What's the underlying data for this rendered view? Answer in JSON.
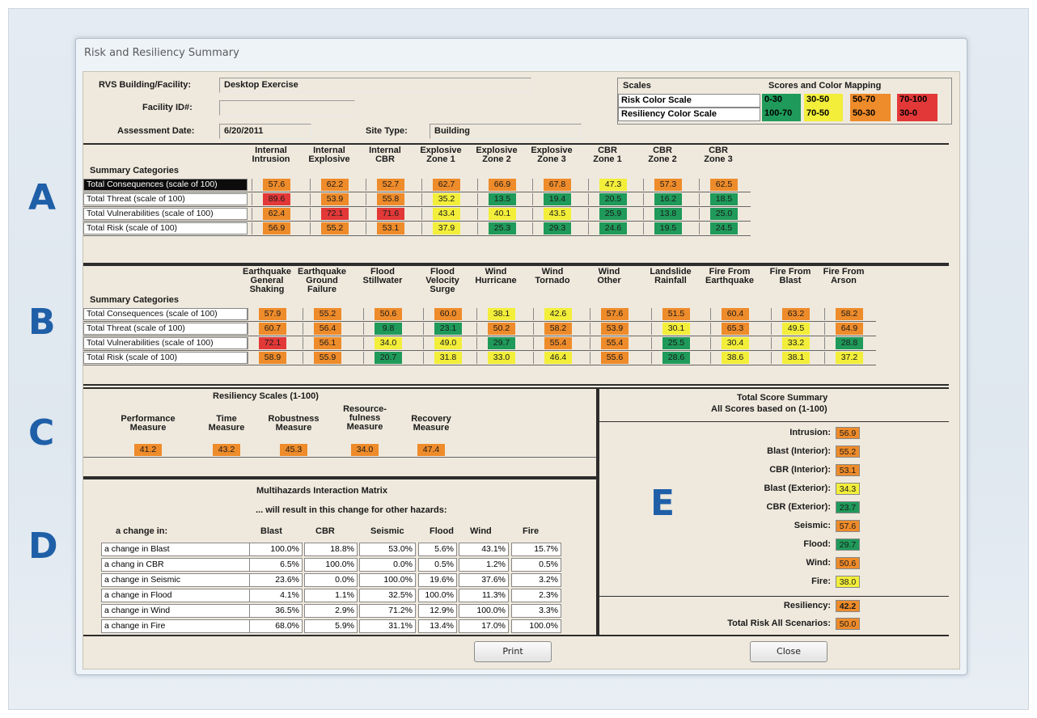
{
  "window": {
    "title": "Risk and Resiliency Summary"
  },
  "letters": [
    "A",
    "B",
    "C",
    "D",
    "E"
  ],
  "colors": {
    "green": "#1f9a5a",
    "yellow": "#f2ee3a",
    "orange": "#ee8b2a",
    "red": "#e23838"
  },
  "header": {
    "facility_label": "RVS Building/Facility:",
    "facility_value": "Desktop Exercise",
    "facility_id_label": "Facility ID#:",
    "facility_id_value": "",
    "date_label": "Assessment Date:",
    "date_value": "6/20/2011",
    "site_type_label": "Site Type:",
    "site_type_value": "Building"
  },
  "scales": {
    "title": "Scales",
    "mapping_title": "Scores and Color Mapping",
    "risk_label": "Risk Color Scale",
    "risk_ranges": [
      "0-30",
      "30-50",
      "50-70",
      "70-100"
    ],
    "resiliency_label": "Resiliency Color Scale",
    "resiliency_ranges": [
      "100-70",
      "70-50",
      "50-30",
      "30-0"
    ]
  },
  "section_a": {
    "cat_header": "Summary Categories",
    "columns": [
      "Internal\nIntrusion",
      "Internal\nExplosive",
      "Internal\nCBR",
      "Explosive\nZone 1",
      "Explosive\nZone 2",
      "Explosive\nZone 3",
      "CBR\nZone 1",
      "CBR\nZone 2",
      "CBR\nZone 3"
    ],
    "rows": [
      {
        "label": "Total Consequences (scale of 100)",
        "values": [
          "57.6",
          "62.2",
          "52.7",
          "62.7",
          "66.9",
          "67.8",
          "47.3",
          "57.3",
          "62.5"
        ]
      },
      {
        "label": "Total Threat (scale of 100)",
        "values": [
          "89.6",
          "53.9",
          "55.8",
          "35.2",
          "13.5",
          "19.4",
          "20.5",
          "16.2",
          "18.5"
        ]
      },
      {
        "label": "Total Vulnerabilities (scale of 100)",
        "values": [
          "62.4",
          "72.1",
          "71.6",
          "43.4",
          "40.1",
          "43.5",
          "25.9",
          "13.8",
          "25.0"
        ]
      },
      {
        "label": "Total Risk (scale of 100)",
        "values": [
          "56.9",
          "55.2",
          "53.1",
          "37.9",
          "25.3",
          "29.3",
          "24.6",
          "19.5",
          "24.5"
        ]
      }
    ]
  },
  "section_b": {
    "cat_header": "Summary Categories",
    "columns": [
      "Earthquake\nGeneral\nShaking",
      "Earthquake\nGround\nFailure",
      "Flood\nStillwater",
      "Flood\nVelocity\nSurge",
      "Wind\nHurricane",
      "Wind\nTornado",
      "Wind\nOther",
      "Landslide\nRainfall",
      "Fire From\nEarthquake",
      "Fire From\nBlast",
      "Fire From\nArson"
    ],
    "rows": [
      {
        "label": "Total Consequences (scale of 100)",
        "values": [
          "57.9",
          "55.2",
          "50.6",
          "60.0",
          "38.1",
          "42.6",
          "57.6",
          "51.5",
          "60.4",
          "63.2",
          "58.2"
        ]
      },
      {
        "label": "Total Threat (scale of 100)",
        "values": [
          "60.7",
          "56.4",
          "9.8",
          "23.1",
          "50.2",
          "58.2",
          "53.9",
          "30.1",
          "65.3",
          "49.5",
          "64.9"
        ]
      },
      {
        "label": "Total Vulnerabilities (scale of 100)",
        "values": [
          "72.1",
          "56.1",
          "34.0",
          "49.0",
          "29.7",
          "55.4",
          "55.4",
          "25.5",
          "30.4",
          "33.2",
          "28.8"
        ]
      },
      {
        "label": "Total Risk (scale of 100)",
        "values": [
          "58.9",
          "55.9",
          "20.7",
          "31.8",
          "33.0",
          "46.4",
          "55.6",
          "28.6",
          "38.6",
          "38.1",
          "37.2"
        ]
      }
    ]
  },
  "section_c": {
    "title": "Resiliency Scales (1-100)",
    "measures": [
      {
        "label": "Performance\nMeasure",
        "value": "41.2"
      },
      {
        "label": "Time\nMeasure",
        "value": "43.2"
      },
      {
        "label": "Robustness\nMeasure",
        "value": "45.3"
      },
      {
        "label": "Resource-\nfulness\nMeasure",
        "value": "34.0"
      },
      {
        "label": "Recovery\nMeasure",
        "value": "47.4"
      }
    ]
  },
  "section_d": {
    "title": "Multihazards Interaction Matrix",
    "subtitle": "... will result in this change for other hazards:",
    "row_header": "a change in:",
    "columns": [
      "Blast",
      "CBR",
      "Seismic",
      "Flood",
      "Wind",
      "Fire"
    ],
    "rows": [
      {
        "label": "a change in Blast",
        "values": [
          "100.0%",
          "18.8%",
          "53.0%",
          "5.6%",
          "43.1%",
          "15.7%"
        ]
      },
      {
        "label": "a chang in CBR",
        "values": [
          "6.5%",
          "100.0%",
          "0.0%",
          "0.5%",
          "1.2%",
          "0.5%"
        ]
      },
      {
        "label": "a change in Seismic",
        "values": [
          "23.6%",
          "0.0%",
          "100.0%",
          "19.6%",
          "37.6%",
          "3.2%"
        ]
      },
      {
        "label": "a change in Flood",
        "values": [
          "4.1%",
          "1.1%",
          "32.5%",
          "100.0%",
          "11.3%",
          "2.3%"
        ]
      },
      {
        "label": "a change in Wind",
        "values": [
          "36.5%",
          "2.9%",
          "71.2%",
          "12.9%",
          "100.0%",
          "3.3%"
        ]
      },
      {
        "label": "a change in Fire",
        "values": [
          "68.0%",
          "5.9%",
          "31.1%",
          "13.4%",
          "17.0%",
          "100.0%"
        ]
      }
    ]
  },
  "section_e": {
    "title": "Total Score Summary",
    "subtitle": "All Scores based on (1-100)",
    "items": [
      {
        "label": "Intrusion:",
        "value": "56.9"
      },
      {
        "label": "Blast (Interior):",
        "value": "55.2"
      },
      {
        "label": "CBR (Interior):",
        "value": "53.1"
      },
      {
        "label": "Blast (Exterior):",
        "value": "34.3"
      },
      {
        "label": "CBR (Exterior):",
        "value": "23.7"
      },
      {
        "label": "Seismic:",
        "value": "57.6"
      },
      {
        "label": "Flood:",
        "value": "29.7"
      },
      {
        "label": "Wind:",
        "value": "50.6"
      },
      {
        "label": "Fire:",
        "value": "38.0"
      }
    ],
    "resiliency_label": "Resiliency:",
    "resiliency_value": "42.2",
    "total_label": "Total Risk All Scenarios:",
    "total_value": "50.0"
  },
  "buttons": {
    "print": "Print",
    "close": "Close"
  }
}
